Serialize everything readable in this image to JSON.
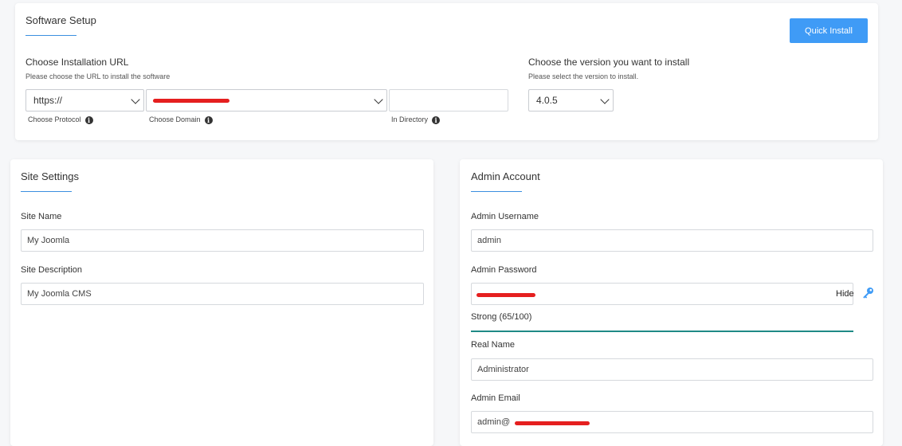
{
  "setup": {
    "title": "Software Setup",
    "quick_install_label": "Quick Install",
    "install_url": {
      "label": "Choose Installation URL",
      "hint": "Please choose the URL to install the software",
      "protocol_value": "https://",
      "protocol_caption": "Choose Protocol",
      "domain_caption": "Choose Domain",
      "directory_value": "",
      "directory_caption": "In Directory"
    },
    "version": {
      "label": "Choose the version you want to install",
      "hint": "Please select the version to install.",
      "value": "4.0.5"
    }
  },
  "site": {
    "title": "Site Settings",
    "name_label": "Site Name",
    "name_value": "My Joomla",
    "description_label": "Site Description",
    "description_value": "My Joomla CMS"
  },
  "admin": {
    "title": "Admin Account",
    "username_label": "Admin Username",
    "username_value": "admin",
    "password_label": "Admin Password",
    "hide_label": "Hide",
    "strength_text": "Strong (65/100)",
    "strength_value": 65,
    "real_name_label": "Real Name",
    "real_name_value": "Administrator",
    "email_label": "Admin Email",
    "email_value_prefix": "admin@"
  },
  "colors": {
    "accent": "#3f9bf6",
    "strength": "#1f8a86",
    "redaction": "#e51f1f"
  }
}
